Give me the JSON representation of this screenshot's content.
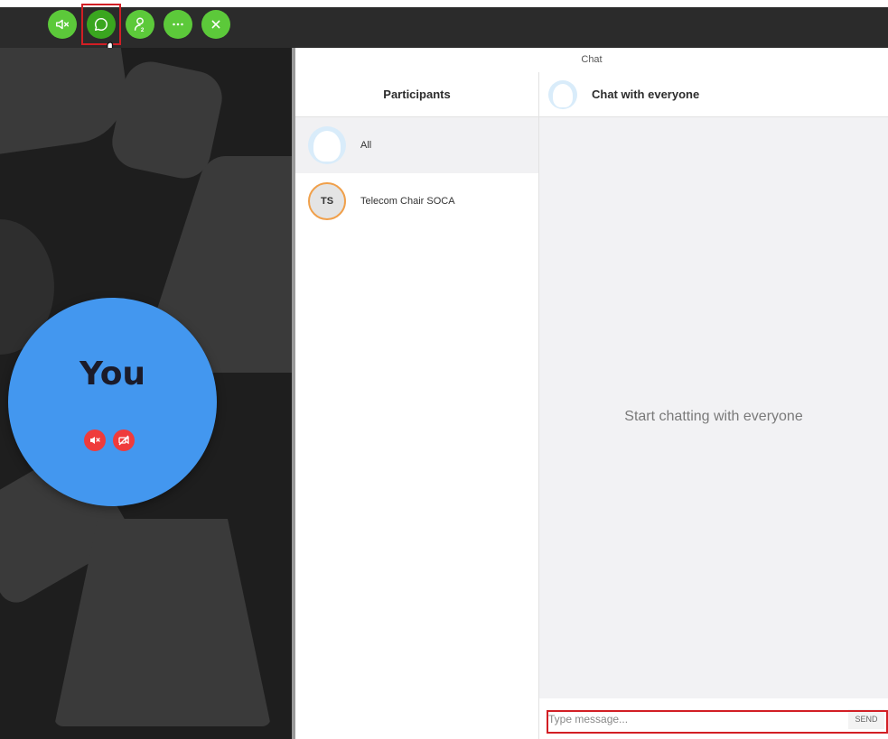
{
  "toolbar": {
    "buttons": [
      {
        "name": "mute-audio",
        "icon": "speaker-muted-icon"
      },
      {
        "name": "chat",
        "icon": "chat-bubble-icon"
      },
      {
        "name": "participants",
        "icon": "person-icon",
        "badge": "2"
      },
      {
        "name": "more",
        "icon": "ellipsis-icon"
      },
      {
        "name": "leave",
        "icon": "close-icon"
      }
    ],
    "accent_color": "#5cc93a"
  },
  "self_view": {
    "label": "You",
    "circle_color": "#4397ef",
    "status_icons": [
      "mic-muted-icon",
      "camera-off-icon"
    ]
  },
  "chat_panel": {
    "title": "Chat",
    "participants_header": "Participants",
    "participants": [
      {
        "initials": "",
        "name": "All",
        "selected": true
      },
      {
        "initials": "TS",
        "name": "Telecom Chair SOCA",
        "selected": false
      }
    ],
    "conversation_header": "Chat with everyone",
    "empty_message": "Start chatting with everyone",
    "input_placeholder": "Type message...",
    "send_label": "SEND"
  }
}
